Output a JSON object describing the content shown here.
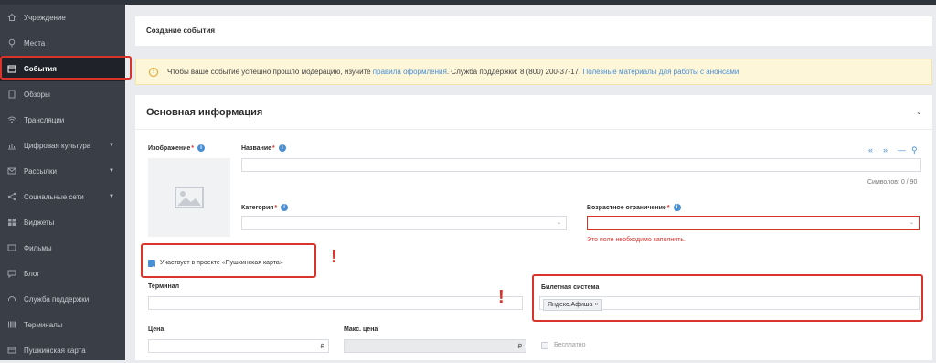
{
  "sidebar": {
    "items": [
      {
        "label": "Учреждение",
        "icon": "home-icon",
        "active": false
      },
      {
        "label": "Места",
        "icon": "location-pin-icon",
        "active": false
      },
      {
        "label": "События",
        "icon": "calendar-icon",
        "active": true
      },
      {
        "label": "Обзоры",
        "icon": "document-icon",
        "active": false
      },
      {
        "label": "Трансляции",
        "icon": "broadcast-icon",
        "active": false
      },
      {
        "label": "Цифровая культура",
        "icon": "chart-icon",
        "active": false,
        "has_caret": true
      },
      {
        "label": "Рассылки",
        "icon": "mail-icon",
        "active": false,
        "has_caret": true
      },
      {
        "label": "Социальные сети",
        "icon": "share-icon",
        "active": false,
        "has_caret": true
      },
      {
        "label": "Виджеты",
        "icon": "grid-icon",
        "active": false
      },
      {
        "label": "Фильмы",
        "icon": "film-icon",
        "active": false
      },
      {
        "label": "Блог",
        "icon": "chat-icon",
        "active": false
      },
      {
        "label": "Служба поддержки",
        "icon": "headset-icon",
        "active": false
      },
      {
        "label": "Терминалы",
        "icon": "barcode-icon",
        "active": false
      },
      {
        "label": "Пушкинская карта",
        "icon": "card-icon",
        "active": false
      }
    ]
  },
  "header": {
    "title": "Создание события"
  },
  "notice": {
    "text_1": "Чтобы ваше событие успешно прошло модерацию, изучите",
    "link_1": "правила оформления",
    "text_2": ". Служба поддержки: 8 (800) 200-37-17.",
    "link_2": "Полезные материалы для работы с анонсами"
  },
  "section": {
    "title": "Основная информация"
  },
  "form": {
    "image_label": "Изображение",
    "name_label": "Название",
    "name_value": "",
    "char_counter": "Символов: 0 / 90",
    "category_label": "Категория",
    "age_label": "Возрастное ограничение",
    "age_error": "Это поле необходимо заполнить.",
    "pushkin_label": "Участвует в проекте «Пушкинская карта»",
    "pushkin_checked": true,
    "terminal_label": "Терминал",
    "ticket_system_label": "Билетная система",
    "ticket_system_tag": "Яндекс.Афиша",
    "tag_remove": "×",
    "price_label": "Цена",
    "max_price_label": "Макс. цена",
    "currency": "₽",
    "free_label": "Бесплатно",
    "required_mark": "*"
  },
  "toolbar": {
    "icons": [
      "«",
      "»",
      "—",
      "⚲"
    ]
  },
  "colors": {
    "sidebar_bg": "#3a3e46",
    "accent": "#4a8fd4",
    "error": "#d9342b",
    "notice_bg": "#fdf6d9"
  }
}
